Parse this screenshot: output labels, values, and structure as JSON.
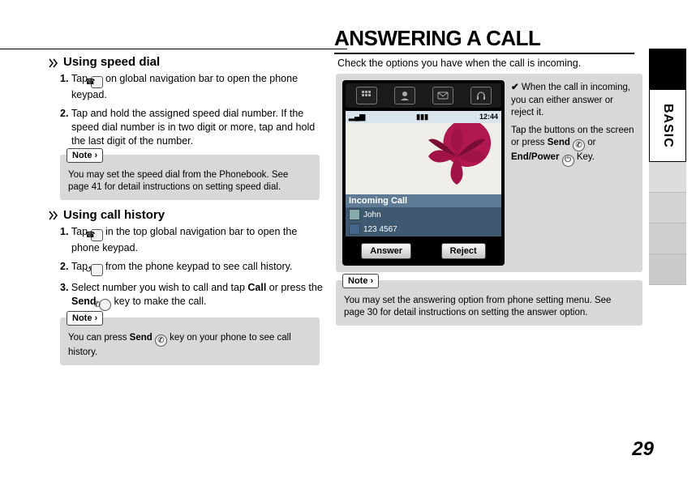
{
  "sideTab": "BASIC",
  "pageNumber": "29",
  "left": {
    "sec1": {
      "heading": "Using speed dial",
      "steps": [
        "Tap __ICON_PHONE__ on global navigation bar to open the phone keypad.",
        "Tap and hold the assigned speed dial number. If the speed dial number is in two digit or more, tap and hold the last digit of the number."
      ],
      "noteLabel": "Note",
      "noteText": "You may set the speed dial from the Phonebook. See page 41 for detail instructions on setting speed dial."
    },
    "sec2": {
      "heading": "Using call history",
      "step1_a": "Tap ",
      "step1_b": " in the top global navigation bar to open the phone keypad.",
      "step2_a": "Tap ",
      "step2_b": " from the phone keypad to see call history.",
      "step3_a": "Select number you wish to call and tap ",
      "step3_call": "Call",
      "step3_b": " or press the ",
      "step3_send": "Send",
      "step3_c": " key to make the call.",
      "noteLabel": "Note",
      "note_a": "You can press ",
      "note_send": "Send",
      "note_b": " key on your phone to see call history."
    }
  },
  "right": {
    "title": "ANSWERING A CALL",
    "subtitle": "Check the options you have when the call is incoming.",
    "phone": {
      "time": "12:44",
      "incomingLabel": "Incoming Call",
      "callerName": "John",
      "callerNumber": "123 4567",
      "answerBtn": "Answer",
      "rejectBtn": "Reject"
    },
    "tip": {
      "p1": "When the call in incoming, you can either answer or reject it.",
      "p2_a": "Tap the buttons on the screen or press ",
      "p2_send": "Send",
      "p2_b": " or ",
      "p2_end": "End/Power",
      "p2_c": " Key."
    },
    "noteLabel": "Note",
    "noteText": "You may set the answering option from phone setting menu. See page 30 for detail instructions on setting the answer option."
  }
}
